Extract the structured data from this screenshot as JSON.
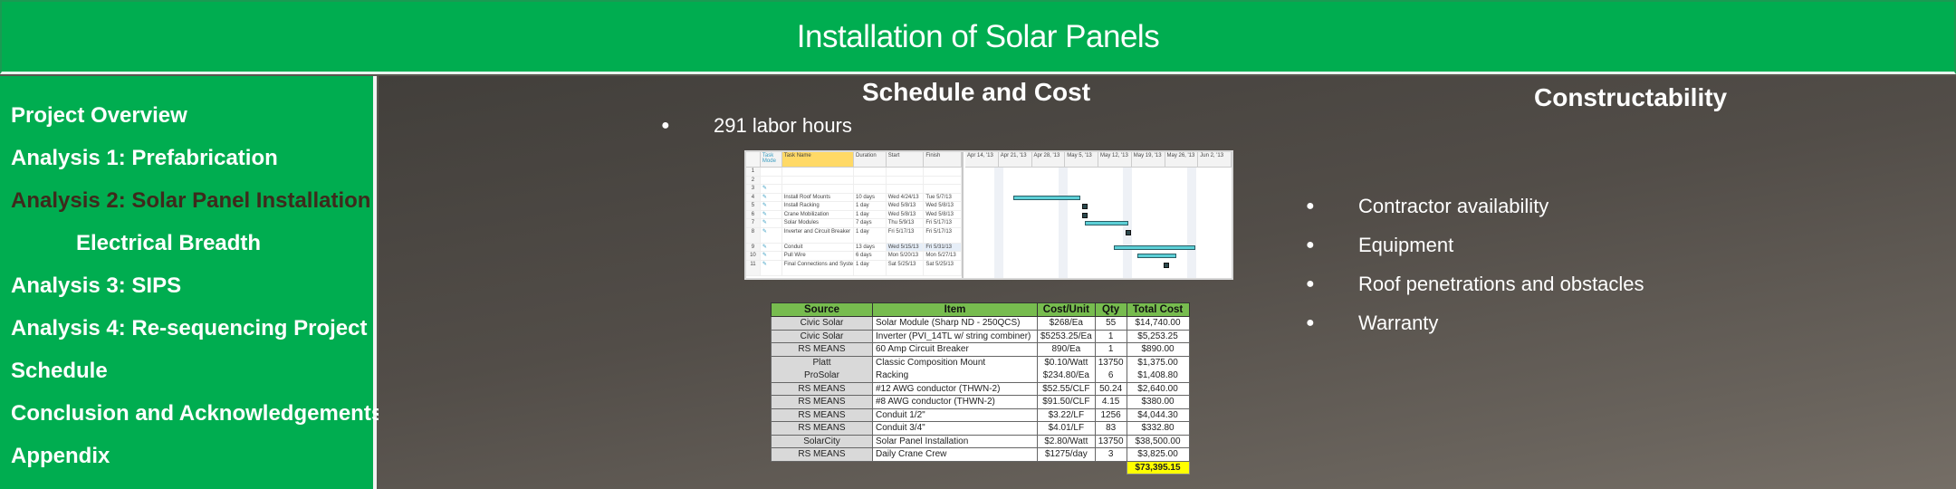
{
  "header": {
    "title": "Installation of Solar Panels"
  },
  "sidebar": {
    "items": [
      {
        "label": "Project Overview",
        "active": false,
        "indent": false
      },
      {
        "label": "Analysis 1: Prefabrication",
        "active": false,
        "indent": false
      },
      {
        "label": "Analysis 2: Solar Panel Installation",
        "active": true,
        "indent": false
      },
      {
        "label": "Electrical Breadth",
        "active": false,
        "indent": true
      },
      {
        "label": "Analysis 3: SIPS",
        "active": false,
        "indent": false
      },
      {
        "label": "Analysis 4: Re-sequencing Project",
        "active": false,
        "indent": false
      },
      {
        "label": "Schedule",
        "active": false,
        "indent": false
      },
      {
        "label": "Conclusion and Acknowledgements",
        "active": false,
        "indent": false
      },
      {
        "label": "Appendix",
        "active": false,
        "indent": false
      }
    ]
  },
  "schedule_cost": {
    "title": "Schedule and Cost",
    "bullets": [
      "291 labor hours"
    ],
    "gantt": {
      "columns": [
        "Task Mode",
        "Task Name",
        "Duration",
        "Start",
        "Finish"
      ],
      "timescale": [
        "Apr 14, '13",
        "Apr 21, '13",
        "Apr 28, '13",
        "May 5, '13",
        "May 12, '13",
        "May 19, '13",
        "May 26, '13",
        "Jun 2, '13"
      ],
      "rows": [
        {
          "id": "1",
          "name": "",
          "duration": "",
          "start": "",
          "finish": ""
        },
        {
          "id": "2",
          "name": "",
          "duration": "",
          "start": "",
          "finish": ""
        },
        {
          "id": "3",
          "name": "",
          "duration": "",
          "start": "",
          "finish": ""
        },
        {
          "id": "4",
          "name": "Install Roof Mounts",
          "duration": "10 days",
          "start": "Wed 4/24/13",
          "finish": "Tue 5/7/13"
        },
        {
          "id": "5",
          "name": "Install Racking",
          "duration": "1 day",
          "start": "Wed 5/8/13",
          "finish": "Wed 5/8/13"
        },
        {
          "id": "6",
          "name": "Crane Mobilization",
          "duration": "1 day",
          "start": "Wed 5/8/13",
          "finish": "Wed 5/8/13"
        },
        {
          "id": "7",
          "name": "Solar Modules",
          "duration": "7 days",
          "start": "Thu 5/9/13",
          "finish": "Fri 5/17/13"
        },
        {
          "id": "8",
          "name": "Inverter and Circuit Breaker",
          "duration": "1 day",
          "start": "Fri 5/17/13",
          "finish": "Fri 5/17/13"
        },
        {
          "id": "9",
          "name": "Conduit",
          "duration": "13 days",
          "start": "Wed 5/15/13",
          "finish": "Fri 5/31/13"
        },
        {
          "id": "10",
          "name": "Pull Wire",
          "duration": "6 days",
          "start": "Mon 5/20/13",
          "finish": "Mon 5/27/13"
        },
        {
          "id": "11",
          "name": "Final Connections and System Checks",
          "duration": "1 day",
          "start": "Sat 5/25/13",
          "finish": "Sat 5/25/13"
        }
      ]
    },
    "cost_table": {
      "headers": [
        "Source",
        "Item",
        "Cost/Unit",
        "Qty",
        "Total Cost"
      ],
      "rows": [
        {
          "source": "Civic Solar",
          "item": "Solar Module (Sharp ND - 250QCS)",
          "cost_unit": "$268/Ea",
          "qty": "55",
          "total": "$14,740.00"
        },
        {
          "source": "Civic Solar",
          "item": "Inverter (PVI_14TL w/ string combiner)",
          "cost_unit": "$5253.25/Ea",
          "qty": "1",
          "total": "$5,253.25"
        },
        {
          "source": "RS MEANS",
          "item": "60 Amp Circuit Breaker",
          "cost_unit": "890/Ea",
          "qty": "1",
          "total": "$890.00"
        },
        {
          "source": "Platt",
          "item": "Classic Composition Mount",
          "cost_unit": "$0.10/Watt",
          "qty": "13750",
          "total": "$1,375.00"
        },
        {
          "source": "ProSolar",
          "item": "Racking",
          "cost_unit": "$234.80/Ea",
          "qty": "6",
          "total": "$1,408.80"
        },
        {
          "source": "RS MEANS",
          "item": "#12 AWG conductor (THWN-2)",
          "cost_unit": "$52.55/CLF",
          "qty": "50.24",
          "total": "$2,640.00"
        },
        {
          "source": "RS MEANS",
          "item": "#8 AWG conductor (THWN-2)",
          "cost_unit": "$91.50/CLF",
          "qty": "4.15",
          "total": "$380.00"
        },
        {
          "source": "RS MEANS",
          "item": "Conduit 1/2\"",
          "cost_unit": "$3.22/LF",
          "qty": "1256",
          "total": "$4,044.30"
        },
        {
          "source": "RS MEANS",
          "item": "Conduit 3/4\"",
          "cost_unit": "$4.01/LF",
          "qty": "83",
          "total": "$332.80"
        },
        {
          "source": "SolarCity",
          "item": "Solar Panel Installation",
          "cost_unit": "$2.80/Watt",
          "qty": "13750",
          "total": "$38,500.00"
        },
        {
          "source": "RS MEANS",
          "item": "Daily Crane Crew",
          "cost_unit": "$1275/day",
          "qty": "3",
          "total": "$3,825.00"
        }
      ],
      "grand_total": "$73,395.15"
    }
  },
  "constructability": {
    "title": "Constructability",
    "bullets": [
      "Contractor availability",
      "Equipment",
      "Roof penetrations and obstacles",
      "Warranty"
    ]
  },
  "colors": {
    "brand_green": "#00ad50",
    "active_nav": "#3e2a1c",
    "table_header": "#77bc4f",
    "total_highlight": "#ffff00",
    "gantt_bar": "#5ccfd6"
  }
}
